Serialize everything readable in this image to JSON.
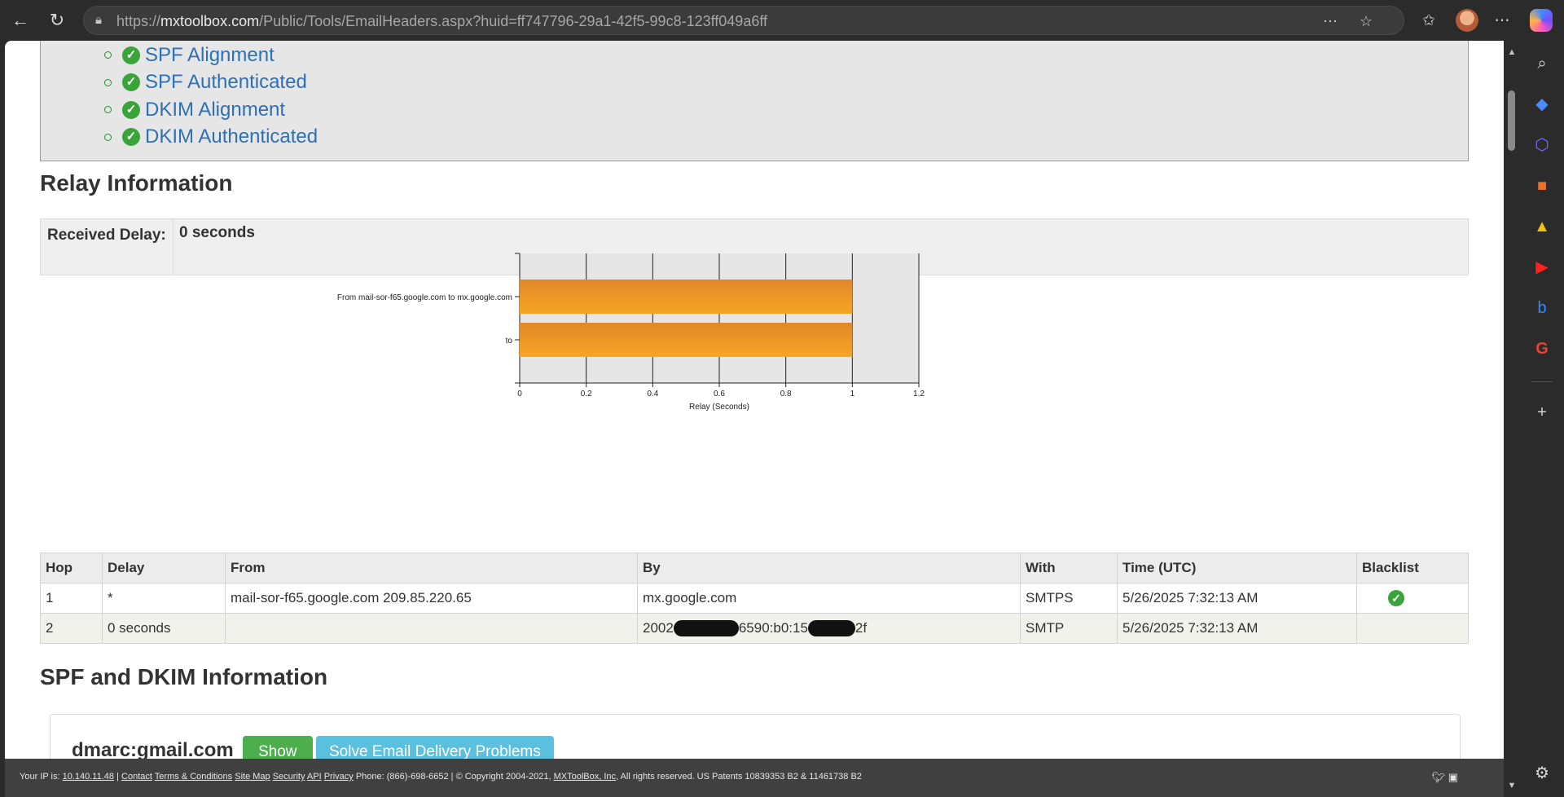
{
  "browser": {
    "url_prefix": "https://",
    "url_host": "mxtoolbox.com",
    "url_path": "/Public/Tools/EmailHeaders.aspx?huid=ff747796-29a1-42f5-99c8-123ff049a6ff"
  },
  "checks": [
    {
      "label": "SPF Alignment",
      "status": "pass"
    },
    {
      "label": "SPF Authenticated",
      "status": "pass"
    },
    {
      "label": "DKIM Alignment",
      "status": "pass"
    },
    {
      "label": "DKIM Authenticated",
      "status": "pass"
    }
  ],
  "relay": {
    "heading": "Relay Information",
    "received_delay_label": "Received Delay:",
    "received_delay_value": "0 seconds"
  },
  "chart_data": {
    "type": "bar",
    "orientation": "horizontal",
    "categories": [
      "From mail-sor-f65.google.com to mx.google.com",
      "to"
    ],
    "values": [
      1,
      1
    ],
    "xlabel": "Relay (Seconds)",
    "xlim": [
      0,
      1.2
    ],
    "ticks": [
      "0",
      "0.2",
      "0.4",
      "0.6",
      "0.8",
      "1",
      "1.2"
    ],
    "grid": true,
    "bar_color": "#f5a623",
    "plot_bg": "#e6e6e6"
  },
  "hops_table": {
    "headers": [
      "Hop",
      "Delay",
      "From",
      "By",
      "With",
      "Time (UTC)",
      "Blacklist"
    ],
    "rows": [
      {
        "hop": "1",
        "delay": "*",
        "from": "mail-sor-f65.google.com 209.85.220.65",
        "by": "mx.google.com",
        "with": "SMTPS",
        "time": "5/26/2025 7:32:13 AM",
        "blacklist": "ok"
      },
      {
        "hop": "2",
        "delay": "0 seconds",
        "from": "",
        "by_parts": [
          "2002",
          "6590:b0:15",
          "2f"
        ],
        "with": "SMTP",
        "time": "5/26/2025 7:32:13 AM",
        "blacklist": ""
      }
    ]
  },
  "spf": {
    "heading": "SPF and DKIM Information",
    "domain": "dmarc:gmail.com",
    "show_label": "Show",
    "solve_label": "Solve Email Delivery Problems"
  },
  "footer": {
    "ip_label": "Your IP is:",
    "ip": "10.140.11.48",
    "links": [
      "Contact",
      "Terms & Conditions",
      "Site Map",
      "Security",
      "API",
      "Privacy"
    ],
    "phone": "Phone: (866)-698-6652",
    "copyright_pre": "© Copyright 2004-2021,",
    "company": "MXToolBox, Inc",
    "copyright_post": ", All rights reserved. US Patents 10839353 B2 & 11461738 B2"
  },
  "colors": {
    "accent_link": "#2d70b5",
    "pass_green": "#3aa43a",
    "show_btn": "#4cae4c",
    "solve_btn": "#5bc0de"
  }
}
